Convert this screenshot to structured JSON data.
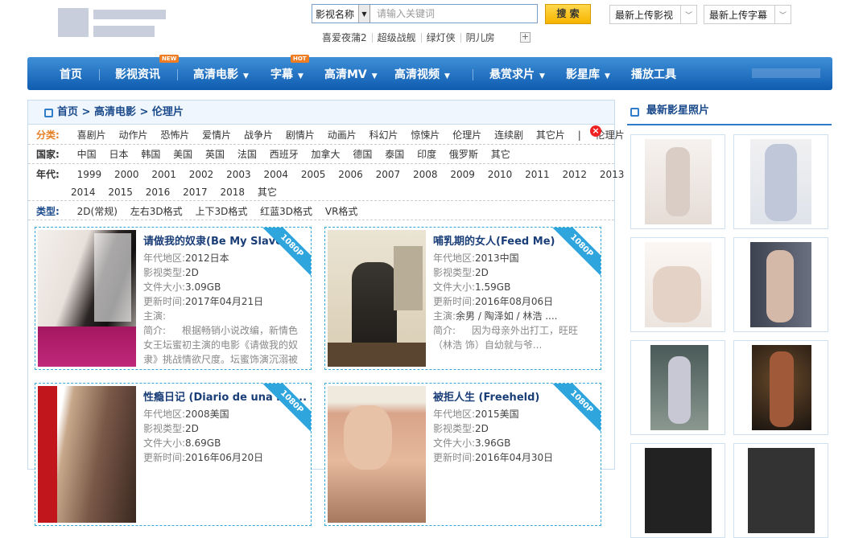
{
  "header": {
    "search": {
      "scope": "影视名称",
      "placeholder": "请输入关键词",
      "button": "搜 索"
    },
    "dropdowns": [
      "最新上传影视",
      "最新上传字幕"
    ],
    "hot_keywords": [
      "喜爱夜蒲2",
      "超级战舰",
      "绿灯侠",
      "阴儿房"
    ],
    "plus": "+"
  },
  "nav": {
    "items": [
      {
        "label": "首页",
        "arrow": false
      },
      {
        "label": "影视资讯",
        "arrow": false,
        "badge": "NEW"
      },
      {
        "label": "高清电影",
        "arrow": true
      },
      {
        "label": "字幕",
        "arrow": true,
        "badge": "HOT"
      },
      {
        "label": "高清MV",
        "arrow": true
      },
      {
        "label": "高清视频",
        "arrow": true
      },
      {
        "label": "悬赏求片",
        "arrow": true
      },
      {
        "label": "影星库",
        "arrow": true
      },
      {
        "label": "播放工具",
        "arrow": false
      }
    ],
    "arrow_glyph": "▼"
  },
  "breadcrumb": "首页 > 高清电影 > 伦理片",
  "filters": {
    "category": {
      "label": "分类:",
      "items": [
        "喜剧片",
        "动作片",
        "恐怖片",
        "爱情片",
        "战争片",
        "剧情片",
        "动画片",
        "科幻片",
        "惊悚片",
        "伦理片",
        "连续剧",
        "其它片"
      ],
      "sep": "|",
      "selected": "伦理片"
    },
    "country": {
      "label": "国家:",
      "items": [
        "中国",
        "日本",
        "韩国",
        "美国",
        "英国",
        "法国",
        "西班牙",
        "加拿大",
        "德国",
        "泰国",
        "印度",
        "俄罗斯",
        "其它"
      ]
    },
    "year": {
      "label": "年代:",
      "row1": [
        "1999",
        "2000",
        "2001",
        "2002",
        "2003",
        "2004",
        "2005",
        "2006",
        "2007",
        "2008",
        "2009",
        "2010",
        "2011",
        "2012",
        "2013"
      ],
      "row2": [
        "2014",
        "2015",
        "2016",
        "2017",
        "2018",
        "其它"
      ]
    },
    "type": {
      "label": "类型:",
      "items": [
        "2D(常规)",
        "左右3D格式",
        "上下3D格式",
        "红蓝3D格式",
        "VR格式"
      ]
    }
  },
  "movies": [
    {
      "title": "请做我的奴隶(Be My Slave)",
      "region": "2012日本",
      "type": "2D",
      "size": "3.09GB",
      "updated": "2017年04月21日",
      "cast": "",
      "intro": "根据畅销小说改编，新情色女王坛蜜初主演的电影《请做我的奴隶》挑战情欲尺度。坛蜜饰演沉溺被虐...",
      "badge": "1080P"
    },
    {
      "title": "哺乳期的女人(Feed Me)",
      "region": "2013中国",
      "type": "2D",
      "size": "1.59GB",
      "updated": "2016年08月06日",
      "cast": "余男 / 陶泽如 / 林浩 ....",
      "intro": "因为母亲外出打工，旺旺（林浩 饰）自幼就与爷...",
      "badge": "1080P"
    },
    {
      "title": "性瘾日记 (Diario de una nin...",
      "region": "2008美国",
      "type": "2D",
      "size": "8.69GB",
      "updated": "2016年06月20日",
      "cast": "",
      "intro": "",
      "badge": "1080P"
    },
    {
      "title": "被拒人生 (Freeheld)",
      "region": "2015美国",
      "type": "2D",
      "size": "3.96GB",
      "updated": "2016年04月30日",
      "cast": "",
      "intro": "",
      "badge": "1080P"
    }
  ],
  "field_labels": {
    "region": "年代地区:",
    "type": "影视类型:",
    "size": "文件大小:",
    "updated": "更新时间:",
    "cast": "主演:",
    "intro": "简介:"
  },
  "sidebar": {
    "title": "最新影星照片"
  },
  "colors": {
    "nav": "#1565b8",
    "accent": "#2f7cc8",
    "badge": "#2fa5dd",
    "search_btn": "#f6b400"
  }
}
